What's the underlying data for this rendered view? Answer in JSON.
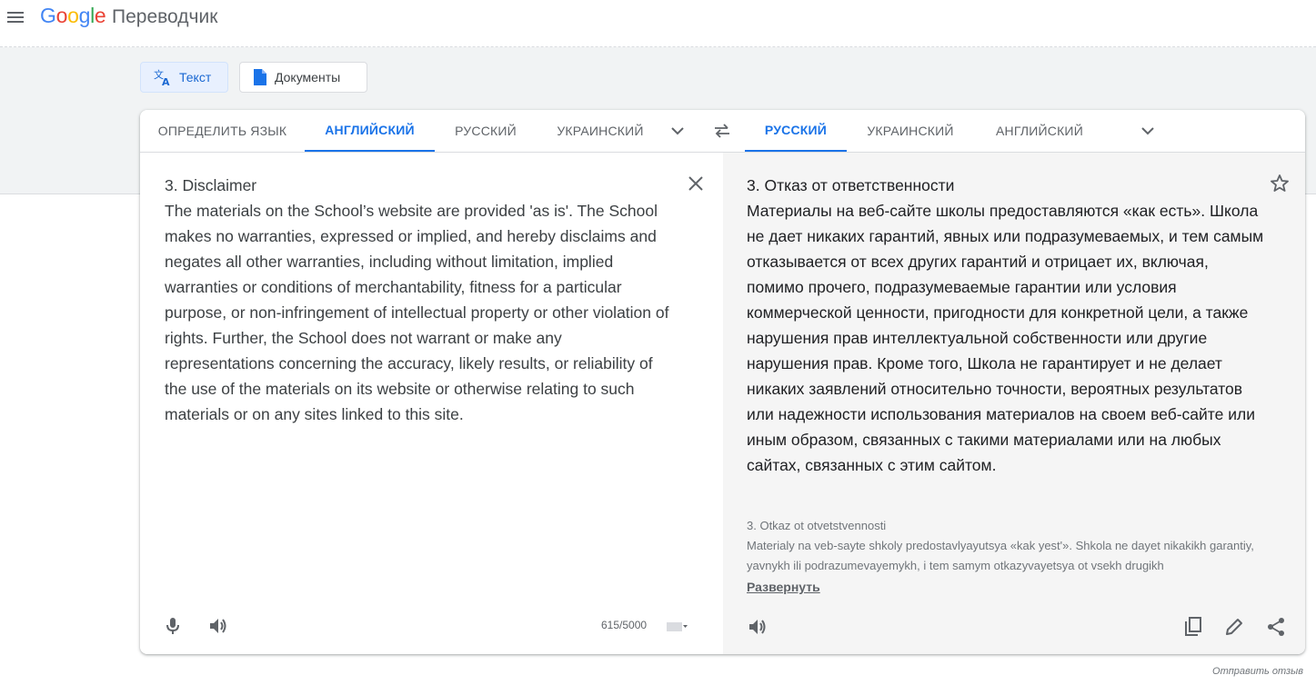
{
  "header": {
    "logo": [
      "G",
      "o",
      "o",
      "g",
      "l",
      "e"
    ],
    "app_name": "Переводчик"
  },
  "modes": {
    "text_label": "Текст",
    "docs_label": "Документы"
  },
  "source_langs": {
    "detect": "ОПРЕДЕЛИТЬ ЯЗЫК",
    "english": "АНГЛИЙСКИЙ",
    "russian": "РУССКИЙ",
    "ukrainian": "УКРАИНСКИЙ"
  },
  "target_langs": {
    "russian": "РУССКИЙ",
    "ukrainian": "УКРАИНСКИЙ",
    "english": "АНГЛИЙСКИЙ"
  },
  "source": {
    "text": "3. Disclaimer\nThe materials on the School’s website are provided 'as is'. The School makes no warranties, expressed or implied, and hereby disclaims and negates all other warranties, including without limitation, implied warranties or conditions of merchantability, fitness for a particular purpose, or non-infringement of intellectual property or other violation of rights. Further, the School does not warrant or make any representations concerning the accuracy, likely results, or reliability of the use of the materials on its website or otherwise relating to such materials or on any sites linked to this site.",
    "char_count": "615/5000"
  },
  "target": {
    "text": "3. Отказ от ответственности\nМатериалы на веб-сайте школы предоставляются «как есть». Школа не дает никаких гарантий, явных или подразумеваемых, и тем самым отказывается от всех других гарантий и отрицает их, включая, помимо прочего, подразумеваемые гарантии или условия коммерческой ценности, пригодности для конкретной цели, а также нарушения прав интеллектуальной собственности или другие нарушения прав. Кроме того, Школа не гарантирует и не делает никаких заявлений относительно точности, вероятных результатов или надежности использования материалов на своем веб-сайте или иным образом, связанных с такими материалами или на любых сайтах, связанных с этим сайтом.",
    "transliteration": "3. Otkaz ot otvetstvennosti\nMaterialy na veb-sayte shkoly predostavlyayutsya «kak yest'». Shkola ne dayet nikakikh garantiy, yavnykh ili podrazumevayemykh, i tem samym otkazyvayetsya ot vsekh drugikh",
    "expand_label": "Развернуть"
  },
  "footer": {
    "feedback": "Отправить отзыв"
  },
  "colors": {
    "accent": "#1a73e8",
    "band": "#f1f3f4",
    "target_bg": "#f5f5f5"
  },
  "icons": [
    "menu-icon",
    "translate-icon",
    "document-icon",
    "chevron-down-icon",
    "swap-icon",
    "close-icon",
    "star-icon",
    "microphone-icon",
    "speaker-icon",
    "keyboard-icon",
    "copy-icon",
    "pencil-icon",
    "share-icon"
  ]
}
